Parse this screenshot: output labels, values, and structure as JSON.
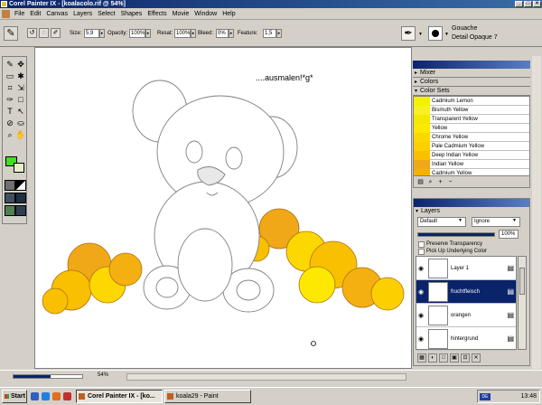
{
  "window": {
    "title": "Corel Painter IX - [koalacolo.rif @ 54%]"
  },
  "menu": [
    "File",
    "Edit",
    "Canvas",
    "Layers",
    "Select",
    "Shapes",
    "Effects",
    "Movie",
    "Window",
    "Help"
  ],
  "propbar": {
    "size_label": "Size:",
    "size_value": "5,9",
    "opacity_label": "Opacity:",
    "opacity_value": "100%",
    "resat_label": "Resat:",
    "resat_value": "100%",
    "bleed_label": "Bleed:",
    "bleed_value": "0%",
    "feature_label": "Feature:",
    "feature_value": "1,5",
    "brush_category": "Gouache",
    "brush_variant": "Detail Opaque 7"
  },
  "canvas": {
    "note": "....ausmalen!*g*"
  },
  "panels": {
    "mixer": "Mixer",
    "colors": "Colors",
    "color_sets": "Color Sets"
  },
  "color_sets": [
    {
      "name": "Cadmium Lemon",
      "color": "#f4f000"
    },
    {
      "name": "Bismuth Yellow",
      "color": "#f8f020"
    },
    {
      "name": "Transparent Yellow",
      "color": "#f4e800"
    },
    {
      "name": "Yellow",
      "color": "#fce800"
    },
    {
      "name": "Chrome Yellow",
      "color": "#fcd800"
    },
    {
      "name": "Pale Cadmium Yellow",
      "color": "#fcd000"
    },
    {
      "name": "Deep Indian Yellow",
      "color": "#f8c000"
    },
    {
      "name": "Indian Yellow",
      "color": "#f0a818"
    },
    {
      "name": "Cadmium Yellow",
      "color": "#f8b000"
    }
  ],
  "layers_panel": {
    "title": "Layers",
    "composite_method": "Default",
    "depth": "Ignore",
    "opacity": "100%",
    "opacity_fraction": 1.0,
    "preserve_transparency": "Preserve Transparency",
    "pick_up_color": "Pick Up Underlying Color",
    "items": [
      {
        "name": "Layer 1"
      },
      {
        "name": "fruchtfleisch"
      },
      {
        "name": "orangen"
      },
      {
        "name": "hintergrund"
      }
    ]
  },
  "status": {
    "zoom": "54%",
    "zoom_fraction": 0.54
  },
  "taskbar": {
    "start": "Start",
    "tasks": [
      "Corel Painter IX - [ko...",
      "koala29 - Paint"
    ],
    "lang": "DE",
    "time": "13:48"
  },
  "colors": {
    "accent": "#0a246a",
    "fg_swatch": "#44dd22",
    "bg_swatch": "#e8eec8",
    "selection": "#0a246a"
  }
}
